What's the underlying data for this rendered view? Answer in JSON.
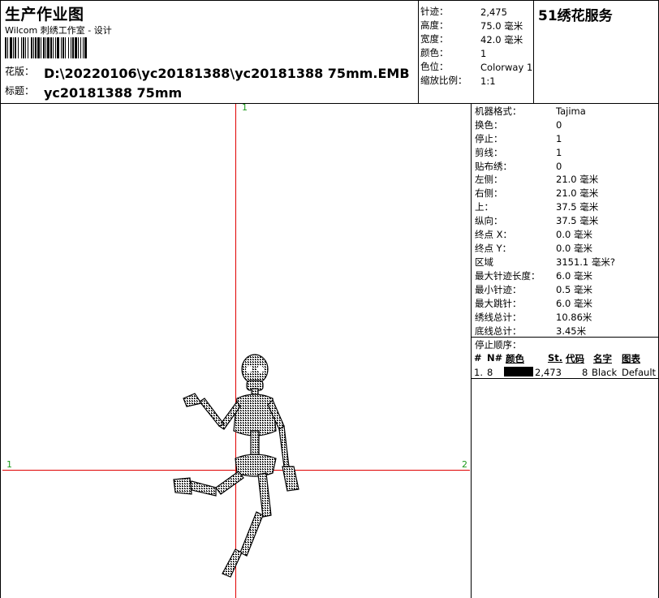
{
  "header": {
    "title": "生产作业图",
    "subtitle": "Wilcom 刺绣工作室 - 设计",
    "design_label": "花版：",
    "design_path": "D:\\20220106\\yc20181388\\yc20181388 75mm.EMB",
    "name_label": "标题：",
    "name_value": "yc20181388 75mm",
    "brand": "51绣花服务"
  },
  "summary": [
    {
      "key": "针迹：",
      "value": "2,475"
    },
    {
      "key": "高度：",
      "value": "75.0 毫米"
    },
    {
      "key": "宽度：",
      "value": "42.0 毫米"
    },
    {
      "key": "颜色：",
      "value": "1"
    },
    {
      "key": "色位：",
      "value": "Colorway 1"
    },
    {
      "key": "缩放比例：",
      "value": "1:1"
    }
  ],
  "stats": [
    {
      "key": "机器格式：",
      "value": "Tajima"
    },
    {
      "key": "换色：",
      "value": "0"
    },
    {
      "key": "停止：",
      "value": "1"
    },
    {
      "key": "剪线：",
      "value": "1"
    },
    {
      "key": "贴布绣：",
      "value": "0"
    },
    {
      "key": "左侧：",
      "value": "21.0 毫米"
    },
    {
      "key": "右侧：",
      "value": "21.0 毫米"
    },
    {
      "key": "上：",
      "value": "37.5 毫米"
    },
    {
      "key": "纵向：",
      "value": "37.5 毫米"
    },
    {
      "key": "终点 X：",
      "value": "0.0 毫米"
    },
    {
      "key": "终点 Y：",
      "value": "0.0 毫米"
    },
    {
      "key": "区域",
      "value": "3151.1 毫米?"
    },
    {
      "key": "最大针迹长度：",
      "value": "6.0 毫米"
    },
    {
      "key": "最小针迹：",
      "value": "0.5 毫米"
    },
    {
      "key": "最大跳针：",
      "value": "6.0 毫米"
    },
    {
      "key": "绣线总计：",
      "value": "10.86米"
    },
    {
      "key": "底线总计：",
      "value": "3.45米"
    }
  ],
  "stop_sequence": {
    "title": "停止顺序：",
    "headers": {
      "num": "#",
      "n": "N#",
      "color": "颜色",
      "st": "St.",
      "code": "代码",
      "name": "名字",
      "chart": "图表"
    },
    "rows": [
      {
        "num": "1.",
        "n": "8",
        "swatch": "#000000",
        "st": "2,473",
        "code": "8",
        "name": "Black",
        "chart": "Default"
      }
    ]
  },
  "canvas": {
    "axis_top": "1",
    "axis_left": "1",
    "axis_right": "2",
    "axis_color": "#e00000",
    "label_color": "#1a9a1a"
  }
}
